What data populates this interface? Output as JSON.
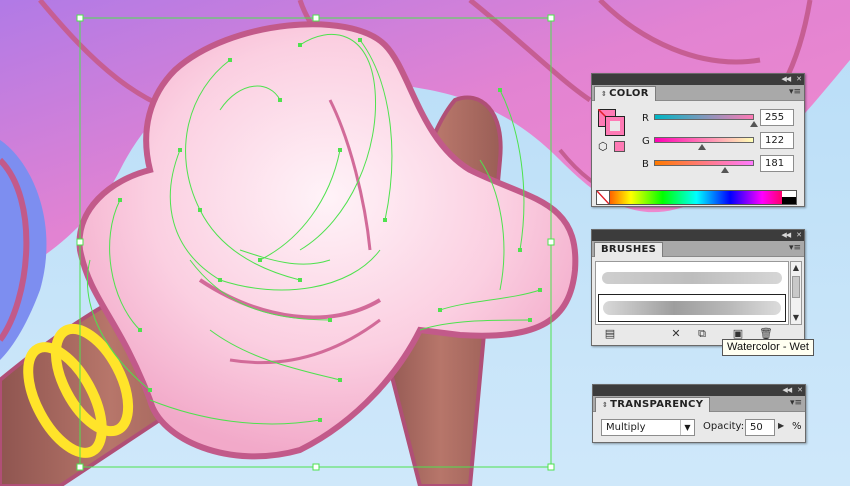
{
  "color_panel": {
    "title": "COLOR",
    "fill_color": "#ff7ab5",
    "channels": [
      {
        "label": "R",
        "value": "255",
        "level": 1.0,
        "gradient": [
          "#00b6c4",
          "#ff7ab5"
        ]
      },
      {
        "label": "G",
        "value": "122",
        "level": 0.478,
        "gradient": [
          "#ff00b5",
          "#ffffb5"
        ]
      },
      {
        "label": "B",
        "value": "181",
        "level": 0.71,
        "gradient": [
          "#ff7a00",
          "#ff7aff"
        ]
      }
    ]
  },
  "brushes_panel": {
    "title": "BRUSHES",
    "tooltip": "Watercolor - Wet",
    "toolbar_icons": [
      "brush-libraries-icon",
      "remove-stroke-icon",
      "brush-options-icon",
      "new-brush-icon",
      "delete-brush-icon"
    ]
  },
  "transparency_panel": {
    "title": "TRANSPARENCY",
    "blend_mode": "Multiply",
    "opacity_label": "Opacity:",
    "opacity_value": "50",
    "opacity_unit": "%"
  },
  "colors": {
    "panel_bg": "#e9e9e9",
    "titlebar_bg": "#3c3c3c",
    "selection_green": "#4ee24e",
    "hair_pink": "#f27ec0",
    "skin": "#a8665c",
    "bracelet": "#ffe42a"
  }
}
